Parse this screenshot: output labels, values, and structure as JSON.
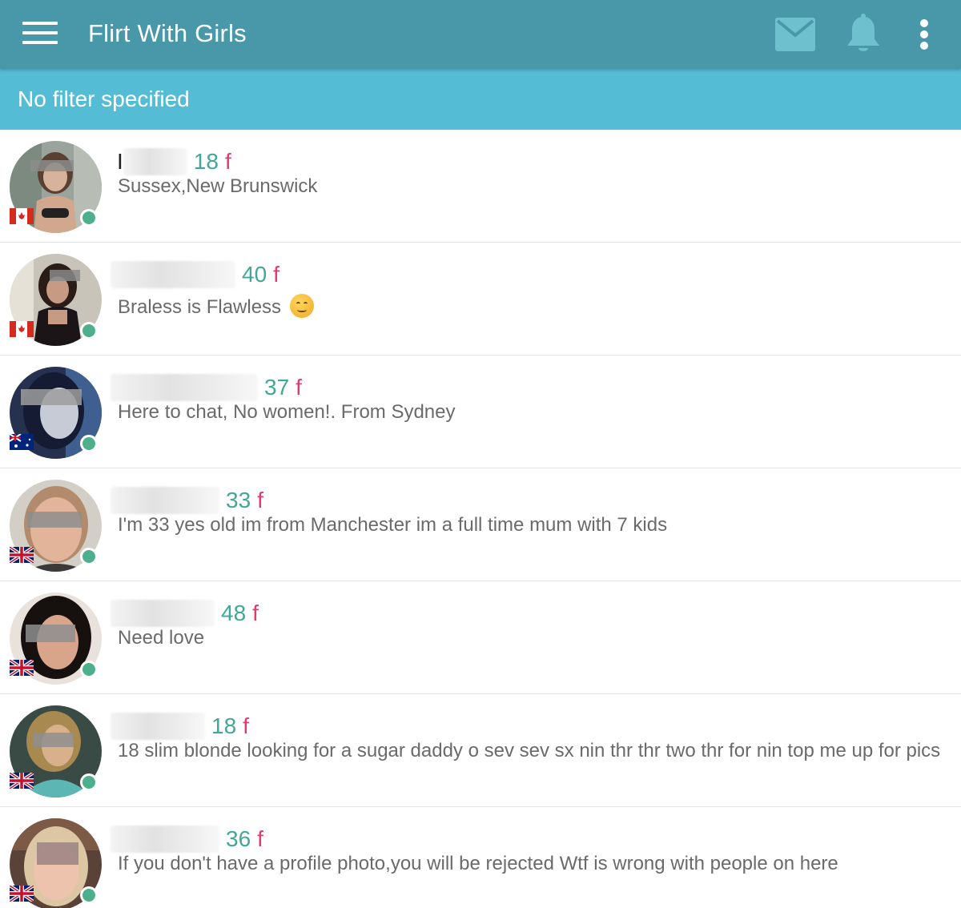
{
  "app": {
    "title": "Flirt With Girls",
    "colors": {
      "appbar": "#4898a9",
      "filter_bar": "#55bcd5",
      "age": "#3fa898",
      "gender": "#e03b6e",
      "online": "#4daf8b"
    }
  },
  "toolbar": {
    "menu_icon": "hamburger-menu-icon",
    "mail_icon": "mail-icon",
    "bell_icon": "bell-icon",
    "more_icon": "more-vert-icon"
  },
  "filter": {
    "label": "No filter specified"
  },
  "profiles": [
    {
      "name_prefix": "I",
      "age": "18",
      "gender": "f",
      "bio": "Sussex,New Brunswick",
      "country": "canada",
      "online": true,
      "emoji": false
    },
    {
      "name_prefix": "",
      "age": "40",
      "gender": "f",
      "bio": "Braless is Flawless",
      "country": "canada",
      "online": true,
      "emoji": true
    },
    {
      "name_prefix": "",
      "age": "37",
      "gender": "f",
      "bio": "Here to chat, No women!. From Sydney",
      "country": "australia",
      "online": true,
      "emoji": false
    },
    {
      "name_prefix": "",
      "age": "33",
      "gender": "f",
      "bio": "I'm 33 yes old im from Manchester im a full time mum with 7 kids",
      "country": "uk",
      "online": true,
      "emoji": false
    },
    {
      "name_prefix": "",
      "age": "48",
      "gender": "f",
      "bio": "Need love",
      "country": "uk",
      "online": true,
      "emoji": false
    },
    {
      "name_prefix": "",
      "age": "18",
      "gender": "f",
      "bio": "18 slim blonde looking for a sugar daddy o sev sev sx nin thr thr two thr for nin top me up for pics",
      "country": "uk",
      "online": true,
      "emoji": false
    },
    {
      "name_prefix": "",
      "age": "36",
      "gender": "f",
      "bio": "If you don't have a profile photo,you will be rejected Wtf is wrong with people on here",
      "country": "uk",
      "online": true,
      "emoji": false
    }
  ]
}
